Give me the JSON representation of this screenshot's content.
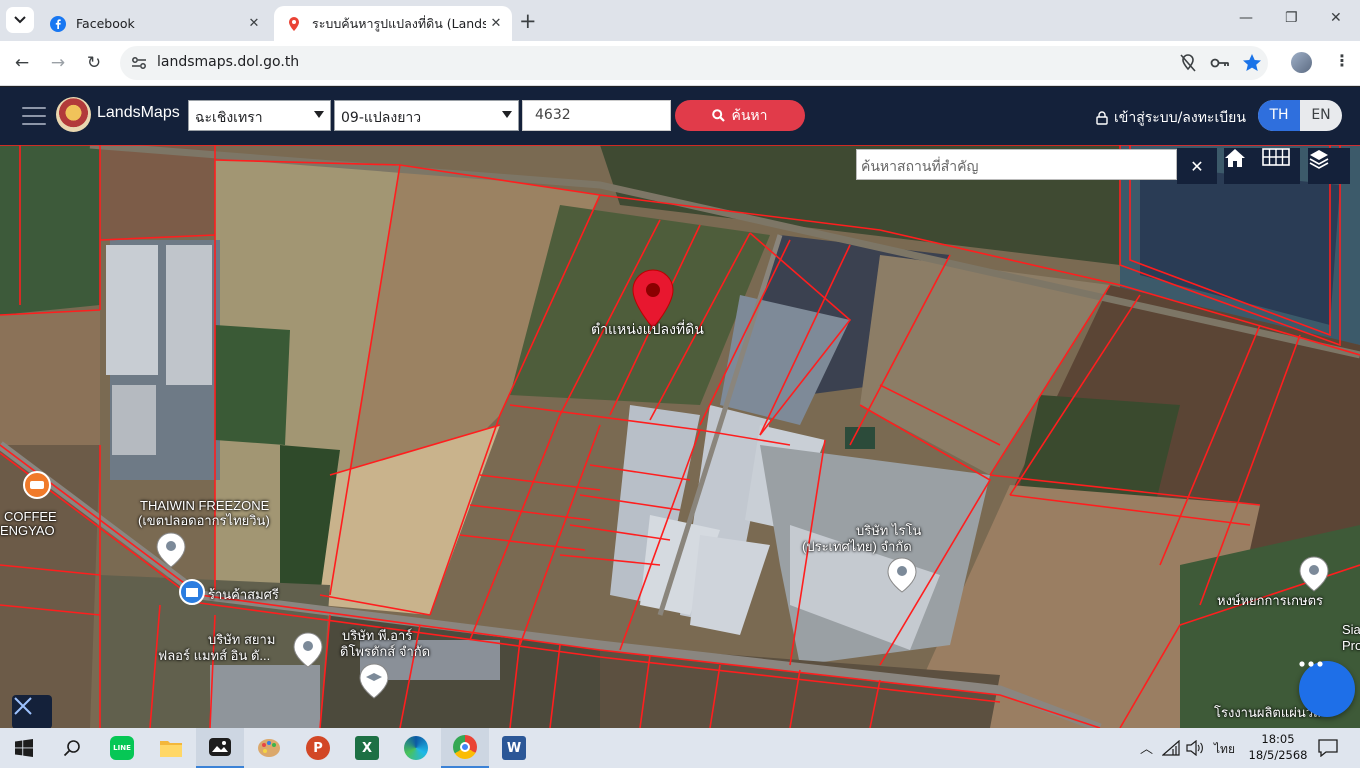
{
  "browser": {
    "tabs": [
      {
        "title": "Facebook",
        "active": false
      },
      {
        "title": "ระบบค้นหารูปแปลงที่ดิน (LandsMaps)",
        "active": true
      }
    ],
    "url": "landsmaps.dol.go.th"
  },
  "site": {
    "brand": "LandsMaps",
    "province": "ฉะเชิงเทรา",
    "district": "09-แปลงยาว",
    "parcel_number": "4632",
    "search_label": "ค้นหา",
    "login_label": "เข้าสู่ระบบ/ลงทะเบียน",
    "lang": {
      "th": "TH",
      "en": "EN",
      "active": "TH"
    }
  },
  "map": {
    "place_search_placeholder": "ค้นหาสถานที่สำคัญ",
    "marker_label": "ตำแหน่งแปลงที่ดิน",
    "labels": {
      "thaiwin_1": "THAIWIN FREEZONE",
      "thaiwin_2": "(เขตปลอดอากรไทยวิน)",
      "coffee_1": "COFFEE",
      "coffee_2": "ENGYAO",
      "shop": "ร้านค้าสมศรี",
      "siam_1": "บริษัท สยาม",
      "siam_2": "ฟลอร์ แมทส์ อิน ดั...",
      "pr_1": "บริษัท พี.อาร์",
      "pr_2": "ดิโพรดักส์ จำกัด",
      "raino_1": "บริษัท ไรโน",
      "raino_2": "(ประเทศไทย) จำกัด",
      "farm": "หงษ์หยกการเกษตร",
      "factory": "โรงงานผลิตแผ่นวัส",
      "edge_1": "Sia",
      "edge_2": "Pro"
    }
  },
  "taskbar": {
    "time": "18:05",
    "date": "18/5/2568",
    "lang": "ไทย"
  },
  "colors": {
    "header": "#14213a",
    "search_button": "#e13b4a",
    "parcel_lines": "#ff1e1e",
    "lang_active": "#2f6fdd",
    "fab": "#1e6fe8"
  }
}
